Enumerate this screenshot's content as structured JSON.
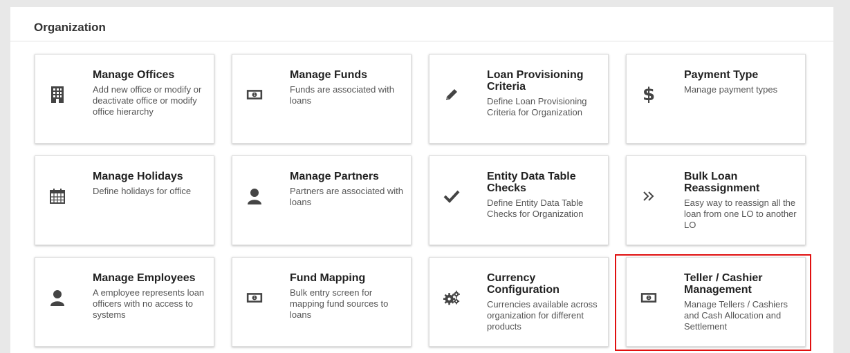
{
  "section": {
    "title": "Organization"
  },
  "cards": [
    {
      "title": "Manage Offices",
      "desc": "Add new office or modify or deactivate office or modify office hierarchy",
      "icon": "building-icon"
    },
    {
      "title": "Manage Funds",
      "desc": "Funds are associated with loans",
      "icon": "money-icon"
    },
    {
      "title": "Loan Provisioning Criteria",
      "desc": "Define Loan Provisioning Criteria for Organization",
      "icon": "pencil-icon"
    },
    {
      "title": "Payment Type",
      "desc": "Manage payment types",
      "icon": "dollar-icon"
    },
    {
      "title": "Manage Holidays",
      "desc": "Define holidays for office",
      "icon": "calendar-icon"
    },
    {
      "title": "Manage Partners",
      "desc": "Partners are associated with loans",
      "icon": "user-icon"
    },
    {
      "title": "Entity Data Table Checks",
      "desc": "Define Entity Data Table Checks for Organization",
      "icon": "check-icon"
    },
    {
      "title": "Bulk Loan Reassignment",
      "desc": "Easy way to reassign all the loan from one LO to another LO",
      "icon": "double-chevron-right-icon"
    },
    {
      "title": "Manage Employees",
      "desc": "A employee represents loan officers with no access to systems",
      "icon": "user-icon"
    },
    {
      "title": "Fund Mapping",
      "desc": "Bulk entry screen for mapping fund sources to loans",
      "icon": "money-icon"
    },
    {
      "title": "Currency Configuration",
      "desc": "Currencies available across organization for different products",
      "icon": "gears-icon"
    },
    {
      "title": "Teller / Cashier Management",
      "desc": "Manage Tellers / Cashiers and Cash Allocation and Settlement",
      "icon": "money-icon"
    }
  ]
}
